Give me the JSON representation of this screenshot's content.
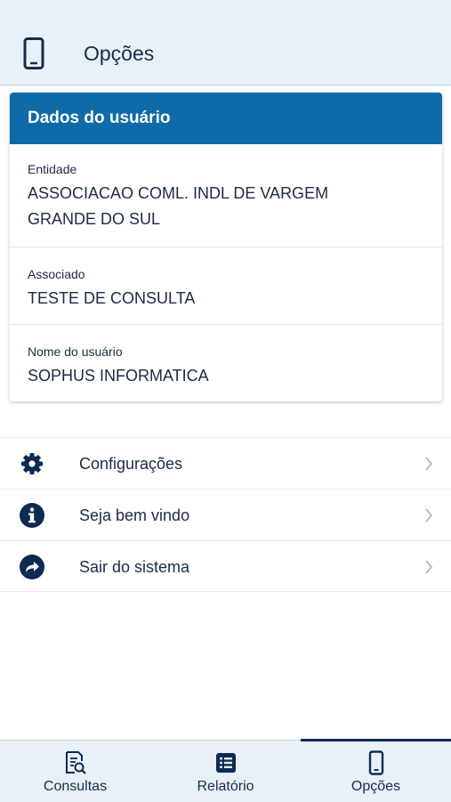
{
  "header": {
    "title": "Opções",
    "icon": "smartphone-icon"
  },
  "user_card": {
    "title": "Dados do usuário",
    "fields": [
      {
        "label": "Entidade",
        "value": "ASSOCIACAO COML. INDL DE VARGEM GRANDE DO SUL"
      },
      {
        "label": "Associado",
        "value": "TESTE DE CONSULTA"
      },
      {
        "label": "Nome do usuário",
        "value": "SOPHUS INFORMATICA"
      }
    ]
  },
  "menu": {
    "items": [
      {
        "label": "Configurações",
        "icon": "gear-icon"
      },
      {
        "label": "Seja bem vindo",
        "icon": "info-icon"
      },
      {
        "label": "Sair do sistema",
        "icon": "share-arrow-icon"
      }
    ]
  },
  "tabbar": {
    "tabs": [
      {
        "label": "Consultas",
        "icon": "search-document-icon",
        "active": false
      },
      {
        "label": "Relatório",
        "icon": "list-icon",
        "active": false
      },
      {
        "label": "Opções",
        "icon": "smartphone-icon",
        "active": true
      }
    ]
  },
  "colors": {
    "accent": "#0e6aa8",
    "header_bg": "#e8f0f8",
    "text": "#1c2b45",
    "active_indicator": "#0d2a52"
  }
}
